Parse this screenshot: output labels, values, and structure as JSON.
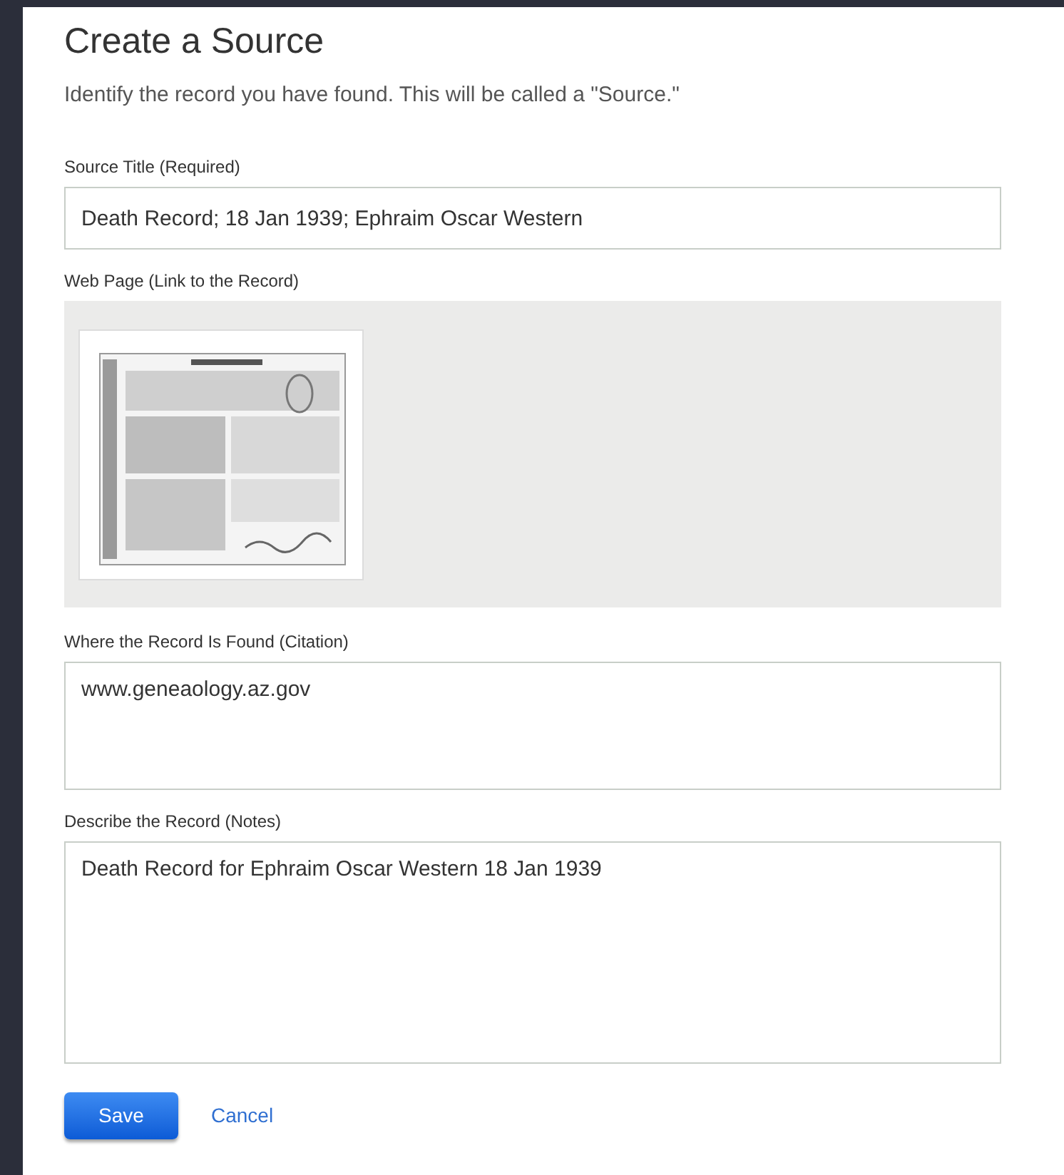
{
  "title": "Create a Source",
  "intro": "Identify the record you have found. This will be called a \"Source.\"",
  "fields": [
    {
      "kind": "input",
      "label": "Source Title (Required)",
      "value": "Death Record; 18 Jan 1939; Ephraim Oscar Western"
    },
    {
      "label": "Web Page (Link to the Record)"
    },
    {
      "kind": "textarea",
      "label": "Where the Record Is Found (Citation)",
      "value": "www.geneaology.az.gov"
    },
    {
      "kind": "textarea_tall",
      "label": "Describe the Record (Notes)",
      "value": "Death Record for Ephraim Oscar Western 18 Jan 1939"
    }
  ],
  "buttons": [
    {
      "kind": "primary",
      "label": "Save"
    },
    {
      "kind": "link",
      "label": "Cancel"
    }
  ]
}
